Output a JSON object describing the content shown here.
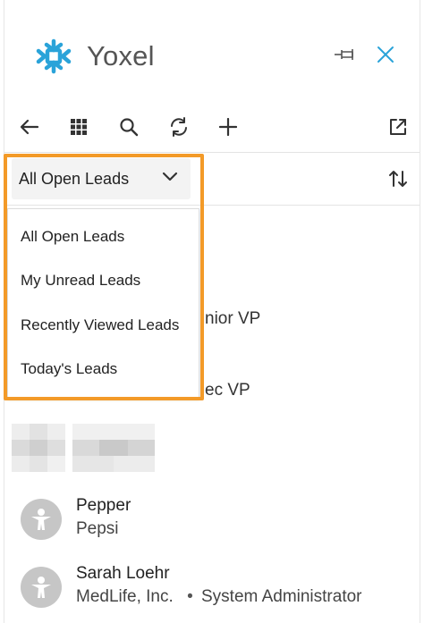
{
  "brand": {
    "name": "Yoxel",
    "color": "#2aa3d9"
  },
  "header": {
    "pin_icon": "pin-icon",
    "close_icon": "close-icon"
  },
  "toolbar": {
    "items": [
      "back-arrow-icon",
      "app-grid-icon",
      "search-icon",
      "refresh-icon",
      "add-icon",
      "open-external-icon"
    ]
  },
  "list_view": {
    "selected": "All Open Leads",
    "sort_icon": "sort-icon",
    "options": [
      "All Open Leads",
      "My Unread Leads",
      "Recently Viewed Leads",
      "Today's Leads"
    ]
  },
  "leads_partial": [
    {
      "text": "nior VP"
    },
    {
      "text": "ec VP"
    }
  ],
  "leads": [
    {
      "name": "Pepper",
      "company": "Pepsi",
      "title": ""
    },
    {
      "name": "Sarah Loehr",
      "company": "MedLife, Inc.",
      "title": "System Administrator"
    }
  ],
  "colors": {
    "accent": "#2aa3d9",
    "highlight": "#f39a28",
    "avatar": "#c6c6c6"
  }
}
